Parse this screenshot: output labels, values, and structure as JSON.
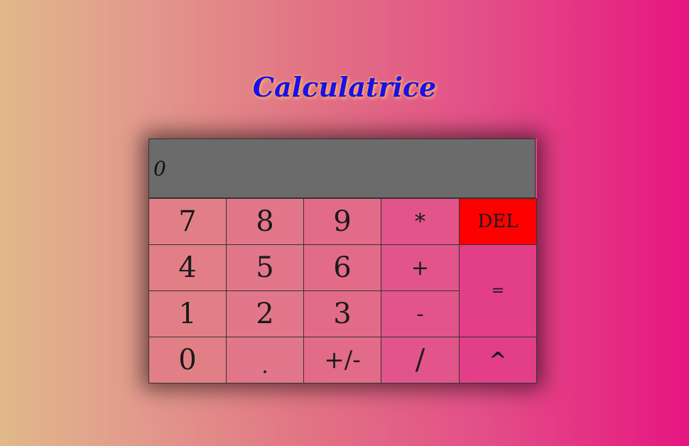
{
  "title": "Calculatrice",
  "display": {
    "value": "0"
  },
  "buttons": {
    "seven": "7",
    "eight": "8",
    "nine": "9",
    "multiply": "*",
    "del": "DEL",
    "four": "4",
    "five": "5",
    "six": "6",
    "plus": "+",
    "equals": "=",
    "one": "1",
    "two": "2",
    "three": "3",
    "minus": "-",
    "zero": "0",
    "dot": ".",
    "sign": "+/-",
    "divide": "/",
    "power": "^"
  },
  "colors": {
    "display_bg": "#6b6b6b",
    "del_bg": "#ff0000",
    "title": "#1a10e8",
    "title_glow": "#ffb566"
  }
}
